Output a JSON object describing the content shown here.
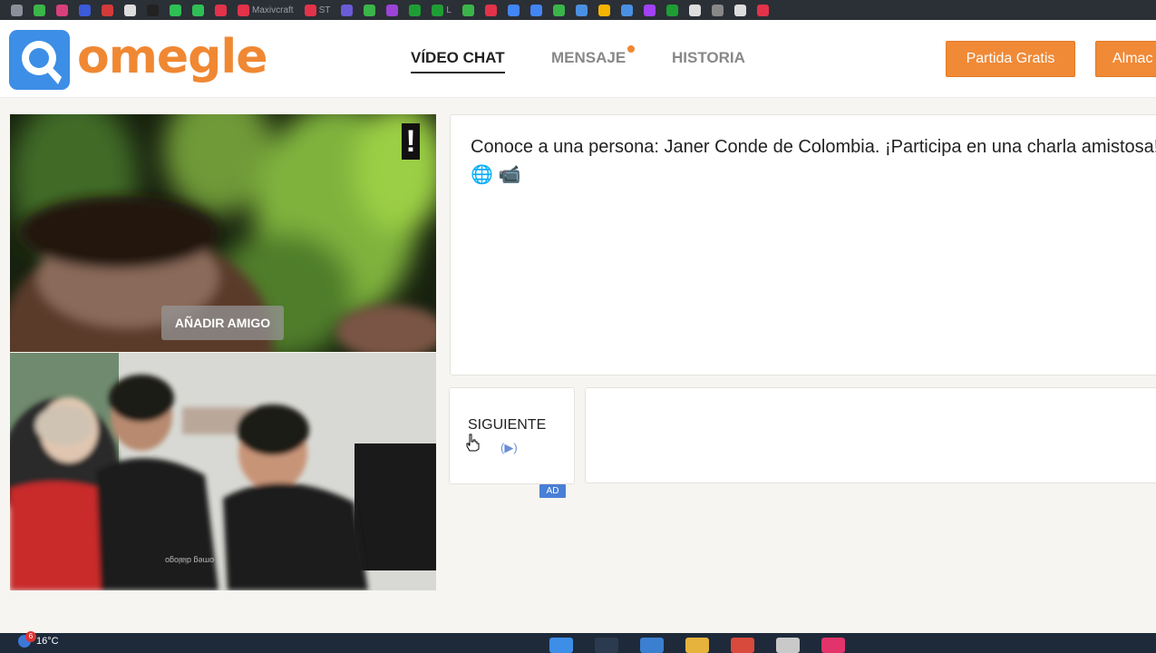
{
  "bookmarks": [
    {
      "label": "",
      "color": "#8a9099"
    },
    {
      "label": "",
      "color": "#3bb54a"
    },
    {
      "label": "",
      "color": "#d8407a"
    },
    {
      "label": "",
      "color": "#3b5bdb"
    },
    {
      "label": "",
      "color": "#d33b3b"
    },
    {
      "label": "",
      "color": "#dddddd"
    },
    {
      "label": "",
      "color": "#222222"
    },
    {
      "label": "",
      "color": "#2fbf55"
    },
    {
      "label": "",
      "color": "#2fbf55"
    },
    {
      "label": "",
      "color": "#e2334a"
    },
    {
      "label": "Maxivcraft",
      "color": "#e2334a"
    },
    {
      "label": "ST",
      "color": "#e2334a"
    },
    {
      "label": "",
      "color": "#6b5bd6"
    },
    {
      "label": "",
      "color": "#3bb54a"
    },
    {
      "label": "",
      "color": "#9b44d6"
    },
    {
      "label": "",
      "color": "#1f9d35"
    },
    {
      "label": "L",
      "color": "#1f9d35"
    },
    {
      "label": "",
      "color": "#3bb54a"
    },
    {
      "label": "",
      "color": "#e2334a"
    },
    {
      "label": "",
      "color": "#4285f4"
    },
    {
      "label": "",
      "color": "#4285f4"
    },
    {
      "label": "",
      "color": "#3bb54a"
    },
    {
      "label": "",
      "color": "#4a90e2"
    },
    {
      "label": "",
      "color": "#f4b400"
    },
    {
      "label": "",
      "color": "#4a90e2"
    },
    {
      "label": "",
      "color": "#a142f4"
    },
    {
      "label": "",
      "color": "#1f9d35"
    },
    {
      "label": "",
      "color": "#dddddd"
    },
    {
      "label": "",
      "color": "#888888"
    },
    {
      "label": "",
      "color": "#dddddd"
    },
    {
      "label": "",
      "color": "#e2334a"
    }
  ],
  "header": {
    "logo_text": "omegle",
    "nav": {
      "video_chat": "VÍDEO CHAT",
      "message": "MENSAJE",
      "history": "HISTORIA"
    },
    "buttons": {
      "free_match": "Partida Gratis",
      "store": "Almac"
    }
  },
  "video": {
    "report_icon": "!",
    "add_friend": "AÑADIR AMIGO",
    "watermark": "omeg dialogo"
  },
  "chat": {
    "message": "Conoce a una persona: Janer Conde de Colombia. ¡Participa en una charla amistosa! 🌐 📹"
  },
  "controls": {
    "next_label": "SIGUIENTE",
    "next_play": "(▶)",
    "ad_badge": "AD"
  },
  "taskbar": {
    "temperature": "16°C",
    "notification_count": "6"
  },
  "colors": {
    "brand_orange": "#f08833",
    "brand_blue": "#3d8ee6",
    "ad_blue": "#4a7fd6"
  }
}
